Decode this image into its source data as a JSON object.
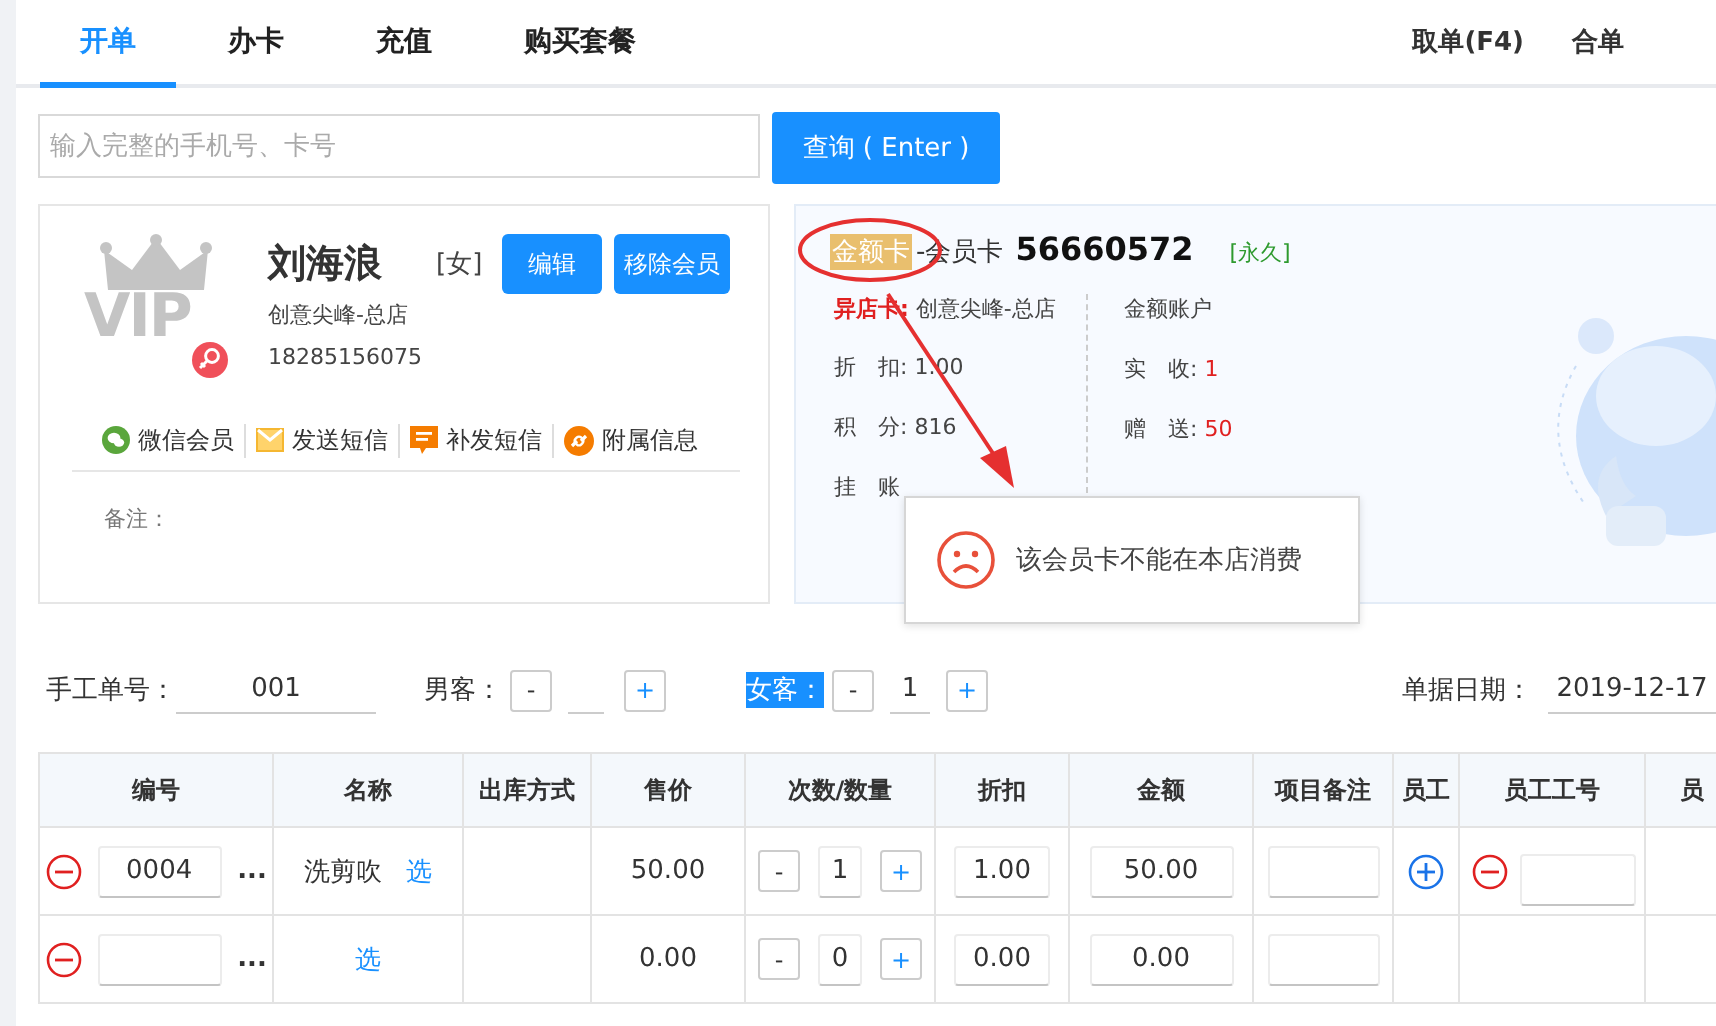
{
  "tabs": [
    {
      "label": "开单",
      "selected": true
    },
    {
      "label": "办卡",
      "selected": false
    },
    {
      "label": "充值",
      "selected": false
    },
    {
      "label": "购买套餐",
      "selected": false
    }
  ],
  "top_actions": [
    "取单(F4)",
    "合单"
  ],
  "search": {
    "placeholder": "输入完整的手机号、卡号",
    "button": "查询 ( Enter )"
  },
  "member": {
    "avatar_text": "VIP",
    "name": "刘海浪",
    "gender": "[女]",
    "store": "创意尖峰-总店",
    "phone": "18285156075",
    "buttons": [
      "编辑",
      "移除会员"
    ],
    "links": [
      {
        "kind": "wechat",
        "label": "微信会员"
      },
      {
        "kind": "mail",
        "label": "发送短信"
      },
      {
        "kind": "message",
        "label": "补发短信"
      },
      {
        "kind": "link",
        "label": "附属信息"
      }
    ],
    "remark_label": "备注："
  },
  "card": {
    "type_badge": "金额卡",
    "type_label": "-会员卡",
    "number": "56660572",
    "validity": "[永久]",
    "other_store_label": "异店卡:",
    "store": "创意尖峰-总店",
    "details": [
      {
        "label": "折　扣:",
        "value": "1.00"
      },
      {
        "label": "积　分:",
        "value": "816"
      },
      {
        "label": "挂　账"
      }
    ],
    "account_title": "金额账户",
    "account": [
      {
        "label": "实　收:",
        "value": "1"
      },
      {
        "label": "赠　送:",
        "value": "50"
      }
    ]
  },
  "toast": {
    "message": "该会员卡不能在本店消费"
  },
  "order": {
    "manual_no_label": "手工单号：",
    "manual_no": "001",
    "male_label": "男客：",
    "female_label": "女客：",
    "female_label_highlighted": true,
    "female_count": "1",
    "date_label": "单据日期：",
    "date": "2019-12-17",
    "minus": "-",
    "plus": "+"
  },
  "table": {
    "columns": [
      "编号",
      "名称",
      "出库方式",
      "售价",
      "次数/数量",
      "折扣",
      "金额",
      "项目备注",
      "员工",
      "员工工号",
      "员"
    ],
    "rows": [
      {
        "code": "0004",
        "more": "...",
        "name": "洗剪吹",
        "pick": "选",
        "price": "50.00",
        "qty": "1",
        "discount": "1.00",
        "amount": "50.00",
        "has_staff": true
      },
      {
        "more": "...",
        "pick": "选",
        "price": "0.00",
        "qty": "0",
        "discount": "0.00",
        "amount": "0.00",
        "has_staff": false
      }
    ]
  }
}
